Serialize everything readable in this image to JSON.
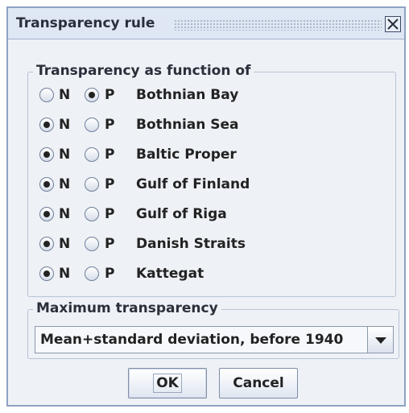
{
  "dialog": {
    "title": "Transparency rule",
    "close_icon": "close-icon"
  },
  "function_group": {
    "legend": "Transparency as function of",
    "option_n_label": "N",
    "option_p_label": "P",
    "rows": [
      {
        "region": "Bothnian Bay",
        "selected": "P"
      },
      {
        "region": "Bothnian Sea",
        "selected": "N"
      },
      {
        "region": "Baltic Proper",
        "selected": "N"
      },
      {
        "region": "Gulf of Finland",
        "selected": "N"
      },
      {
        "region": "Gulf of Riga",
        "selected": "N"
      },
      {
        "region": "Danish Straits",
        "selected": "N"
      },
      {
        "region": "Kattegat",
        "selected": "N"
      }
    ]
  },
  "max_group": {
    "legend": "Maximum transparency",
    "selected_value": "Mean+standard deviation, before 1940"
  },
  "buttons": {
    "ok": "OK",
    "cancel": "Cancel"
  }
}
